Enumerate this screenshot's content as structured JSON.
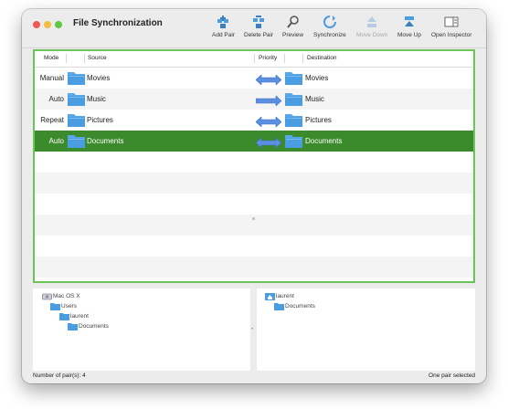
{
  "window": {
    "title": "File Synchronization"
  },
  "toolbar": {
    "add_pair": "Add Pair",
    "delete_pair": "Delete Pair",
    "preview": "Preview",
    "synchronize": "Synchronize",
    "move_down": "Move Down",
    "move_up": "Move Up",
    "open_inspector": "Open Inspector"
  },
  "table": {
    "headers": {
      "mode": "Mode",
      "source": "Source",
      "priority": "Priority",
      "destination": "Destination"
    },
    "rows": [
      {
        "mode": "Manual",
        "source": "Movies",
        "destination": "Movies",
        "priority_icon": "bidirectional-arrow-icon"
      },
      {
        "mode": "Auto",
        "source": "Music",
        "destination": "Music",
        "priority_icon": "right-arrow-icon"
      },
      {
        "mode": "Repeat",
        "source": "Pictures",
        "destination": "Pictures",
        "priority_icon": "bidirectional-arrow-icon"
      },
      {
        "mode": "Auto",
        "source": "Documents",
        "destination": "Documents",
        "priority_icon": "bidirectional-arrow-icon",
        "selected": true
      }
    ]
  },
  "source_tree": [
    "Mac OS X",
    "Users",
    "laurent",
    "Documents"
  ],
  "destination_tree": [
    "laurent",
    "Documents"
  ],
  "status": {
    "left": "Number of pair(s): 4",
    "right": "One pair selected"
  },
  "colors": {
    "selection": "#3b8a2b",
    "table_border": "#6cc35c",
    "folder": "#4a9de0",
    "arrow": "#5b8fe0"
  }
}
